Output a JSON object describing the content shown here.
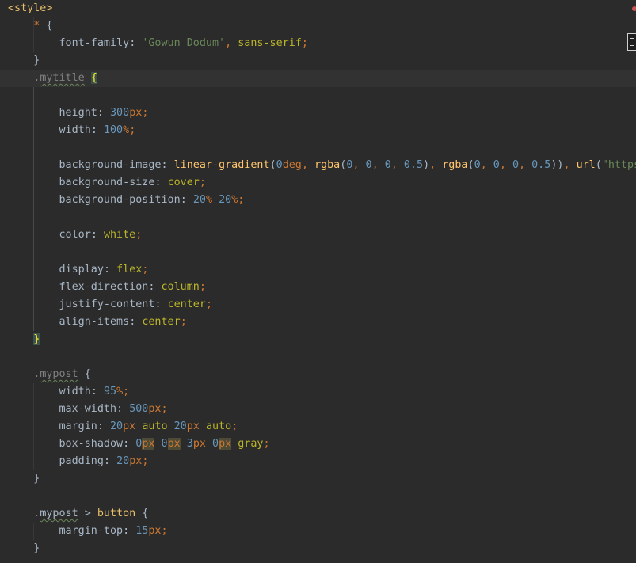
{
  "editor": {
    "language": "css",
    "theme_colors": {
      "background": "#2b2b2b",
      "current_line": "#323232",
      "keyword": "#cc7832",
      "number": "#6897bb",
      "string": "#6a8759",
      "function": "#ffc66d",
      "tag": "#e8bf6a"
    },
    "tokens": {
      "style_open": "<style>",
      "star": "*",
      "brace_open": "{",
      "brace_close": "}",
      "font_family_prop": "font-family",
      "font_family_str": "'Gowun Dodum'",
      "font_family_rest": "sans-serif",
      "mytitle_class": "mytitle",
      "height_prop": "height",
      "height_num": "300",
      "width_prop": "width",
      "width_num": "100",
      "bgimage_prop": "background-image",
      "bgimage_fn": "linear-gradient",
      "bgimage_deg": "0",
      "bgimage_deg_unit": "deg",
      "rgba_fn": "rgba",
      "zero": "0",
      "half": "0.5",
      "url_fn": "url",
      "url_str": "\"https",
      "bgsize_prop": "background-size",
      "cover": "cover",
      "bgpos_prop": "background-position",
      "bgpos_num": "20",
      "color_prop": "color",
      "white": "white",
      "display_prop": "display",
      "flex": "flex",
      "flexdir_prop": "flex-direction",
      "column": "column",
      "justify_prop": "justify-content",
      "center": "center",
      "align_prop": "align-items",
      "mypost_class": "mypost",
      "width_95": "95",
      "maxwidth_prop": "max-width",
      "maxwidth_num": "500",
      "margin_prop": "margin",
      "margin_20": "20",
      "auto": "auto",
      "boxshadow_prop": "box-shadow",
      "three": "3",
      "gray": "gray",
      "padding_prop": "padding",
      "padding_num": "20",
      "button_tag": "button",
      "margintop_prop": "margin-top",
      "margintop_num": "15",
      "px": "px",
      "pct": "%",
      "gt": ">",
      "colon": ":",
      "semi": ";",
      "comma": ",",
      "dot": ".",
      "lparen": "(",
      "rparen": ")"
    }
  }
}
